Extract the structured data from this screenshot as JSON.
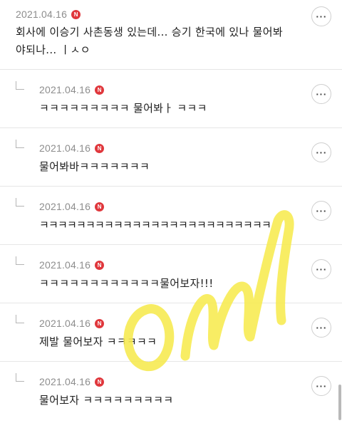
{
  "comments": [
    {
      "date": "2021.04.16",
      "badge": "N",
      "text": "회사에 이승기 사촌동생 있는데... 승기 한국에 있나 물어봐\n야되나... ㅣㅅㅇ",
      "more": "···"
    },
    {
      "date": "2021.04.16",
      "badge": "N",
      "text": "ㅋㅋㅋㅋㅋㅋㅋㅋㅋ 물어봐ㅏ ㅋㅋㅋ",
      "more": "···"
    },
    {
      "date": "2021.04.16",
      "badge": "N",
      "text": "물어봐바ㅋㅋㅋㅋㅋㅋㅋ",
      "more": "···"
    },
    {
      "date": "2021.04.16",
      "badge": "N",
      "text": "ㅋㅋㅋㅋㅋㅋㅋㅋㅋㅋㅋㅋㅋㅋㅋㅋㅋㅋㅋㅋㅋㅋㅋㅋㅋ",
      "more": "···"
    },
    {
      "date": "2021.04.16",
      "badge": "N",
      "text": "ㅋㅋㅋㅋㅋㅋㅋㅋㅋㅋㅋㅋ물어보자!!!",
      "more": "···"
    },
    {
      "date": "2021.04.16",
      "badge": "N",
      "text": "제발 물어보자 ㅋㅋㅋㅋㅋ",
      "more": "···"
    },
    {
      "date": "2021.04.16",
      "badge": "N",
      "text": "물어보자 ㅋㅋㅋㅋㅋㅋㅋㅋㅋ",
      "more": "···"
    }
  ],
  "watermark": {
    "color": "#f7ea4e"
  },
  "colors": {
    "badge": "#e0373c",
    "date": "#8d8d8d",
    "divider": "#e6e6e6"
  }
}
